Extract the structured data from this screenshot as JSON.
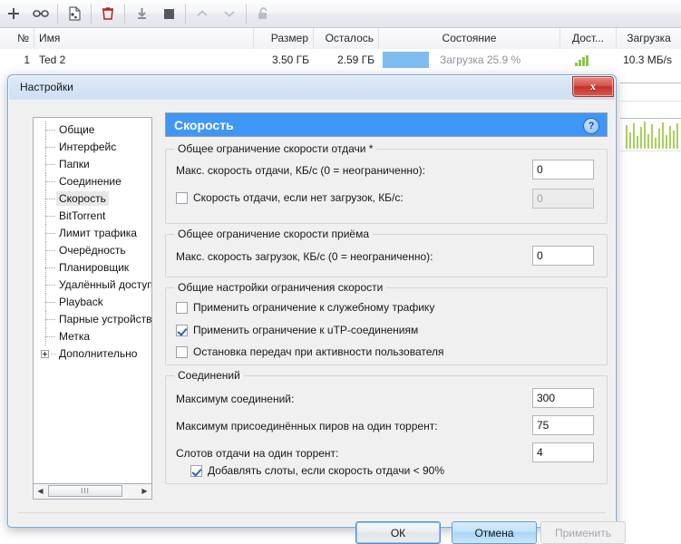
{
  "toolbar": {
    "icons": [
      {
        "name": "add-torrent-icon",
        "glyph": "+"
      },
      {
        "name": "add-torrent-from-url-icon",
        "glyph": "link"
      },
      {
        "name": "create-torrent-icon",
        "glyph": "file"
      },
      {
        "name": "remove-torrent-icon",
        "glyph": "trash"
      },
      {
        "name": "start-torrent-icon",
        "glyph": "download"
      },
      {
        "name": "stop-torrent-icon",
        "glyph": "square"
      },
      {
        "name": "move-up-icon",
        "glyph": "chevron-up"
      },
      {
        "name": "move-down-icon",
        "glyph": "chevron-down"
      },
      {
        "name": "unlock-icon",
        "glyph": "padlock-open"
      }
    ]
  },
  "torrent_list": {
    "columns": [
      "№",
      "Имя",
      "Размер",
      "Осталось",
      "Состояние",
      "Дост...",
      "Загрузка"
    ],
    "rows": [
      {
        "num": "1",
        "name": "Ted 2",
        "size": "3.50 ГБ",
        "remaining": "2.59 ГБ",
        "status": "Загрузка 25.9 %",
        "progress_percent": 25.9,
        "availability_bars": 4,
        "download_speed": "10.3 МБ/s"
      }
    ]
  },
  "dialog": {
    "title": "Настройки",
    "close_label": "x",
    "tree": {
      "items": [
        {
          "label": "Общие",
          "selected": false,
          "expandable": false
        },
        {
          "label": "Интерфейс",
          "selected": false,
          "expandable": false
        },
        {
          "label": "Папки",
          "selected": false,
          "expandable": false
        },
        {
          "label": "Соединение",
          "selected": false,
          "expandable": false
        },
        {
          "label": "Скорость",
          "selected": true,
          "expandable": false
        },
        {
          "label": "BitTorrent",
          "selected": false,
          "expandable": false
        },
        {
          "label": "Лимит трафика",
          "selected": false,
          "expandable": false
        },
        {
          "label": "Очерёдность",
          "selected": false,
          "expandable": false
        },
        {
          "label": "Планировщик",
          "selected": false,
          "expandable": false
        },
        {
          "label": "Удалённый доступ",
          "selected": false,
          "expandable": false
        },
        {
          "label": "Playback",
          "selected": false,
          "expandable": false
        },
        {
          "label": "Парные устройства",
          "selected": false,
          "expandable": false
        },
        {
          "label": "Метка",
          "selected": false,
          "expandable": false
        },
        {
          "label": "Дополнительно",
          "selected": false,
          "expandable": true
        }
      ],
      "scrollbar": {
        "left_arrow": "◀",
        "right_arrow": "▶",
        "thumb_grip": "III"
      }
    },
    "pane": {
      "header": "Скорость",
      "help_glyph": "?",
      "groups": [
        {
          "title": "Общее ограничение скорости отдачи *",
          "rows": [
            {
              "type": "field",
              "label": "Макс. скорость отдачи, КБ/с (0 = неограниченно):",
              "value": "0",
              "disabled": false
            },
            {
              "type": "checkfield",
              "label": "Скорость отдачи, если нет загрузок, КБ/с:",
              "checked": false,
              "value": "0",
              "disabled": true
            }
          ]
        },
        {
          "title": "Общее ограничение скорости приёма",
          "rows": [
            {
              "type": "field",
              "label": "Макс. скорость загрузок, КБ/с (0 = неограниченно):",
              "value": "0",
              "disabled": false
            }
          ]
        },
        {
          "title": "Общие настройки ограничения скорости",
          "rows": [
            {
              "type": "check",
              "label": "Применить ограничение к служебному трафику",
              "checked": false
            },
            {
              "type": "check",
              "label": "Применить ограничение к uTP-соединениям",
              "checked": true
            },
            {
              "type": "check",
              "label": "Остановка передач при активности пользователя",
              "checked": false
            }
          ]
        },
        {
          "title": "Соединений",
          "rows": [
            {
              "type": "field",
              "label": "Максимум соединений:",
              "value": "300",
              "disabled": false
            },
            {
              "type": "field",
              "label": "Максимум присоединённых пиров на один торрент:",
              "value": "75",
              "disabled": false
            },
            {
              "type": "field",
              "label": "Слотов отдачи на один торрент:",
              "value": "4",
              "disabled": false
            },
            {
              "type": "check",
              "label": "Добавлять слоты, если скорость отдачи < 90%",
              "checked": true
            }
          ]
        }
      ]
    },
    "buttons": {
      "ok": "ОК",
      "cancel": "Отмена",
      "apply": "Применить"
    }
  },
  "colors": {
    "header_blue": "#3f97f5",
    "progress_blue": "#7ebdf0",
    "availability_green": "#8ec642",
    "close_red": "#c4332b",
    "dialog_bg": "#f0f0f0"
  }
}
